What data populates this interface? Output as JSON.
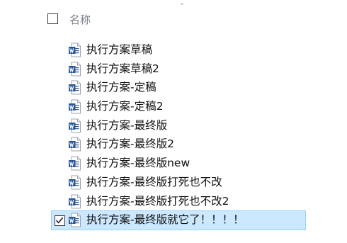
{
  "top_mark": "\"",
  "header": {
    "name_label": "名称"
  },
  "files": [
    {
      "name": "执行方案草稿",
      "icon": "word-doc-icon",
      "selected": false
    },
    {
      "name": "执行方案草稿2",
      "icon": "word-doc-icon",
      "selected": false
    },
    {
      "name": "执行方案-定稿",
      "icon": "word-doc-icon",
      "selected": false
    },
    {
      "name": "执行方案-定稿2",
      "icon": "word-doc-icon",
      "selected": false
    },
    {
      "name": "执行方案-最终版",
      "icon": "word-doc-icon",
      "selected": false
    },
    {
      "name": "执行方案-最终版2",
      "icon": "word-doc-icon",
      "selected": false
    },
    {
      "name": "执行方案-最终版new",
      "icon": "word-doc-icon",
      "selected": false
    },
    {
      "name": "执行方案-最终版打死也不改",
      "icon": "word-doc-icon",
      "selected": false
    },
    {
      "name": "执行方案-最终版打死也不改2",
      "icon": "word-doc-icon",
      "selected": false
    },
    {
      "name": "执行方案-最终版就它了！！！！",
      "icon": "word-doc-icon",
      "selected": true
    }
  ],
  "colors": {
    "selection_fill": "#cce8ff",
    "selection_border": "#99d1ff",
    "word_blue": "#2b579a"
  }
}
